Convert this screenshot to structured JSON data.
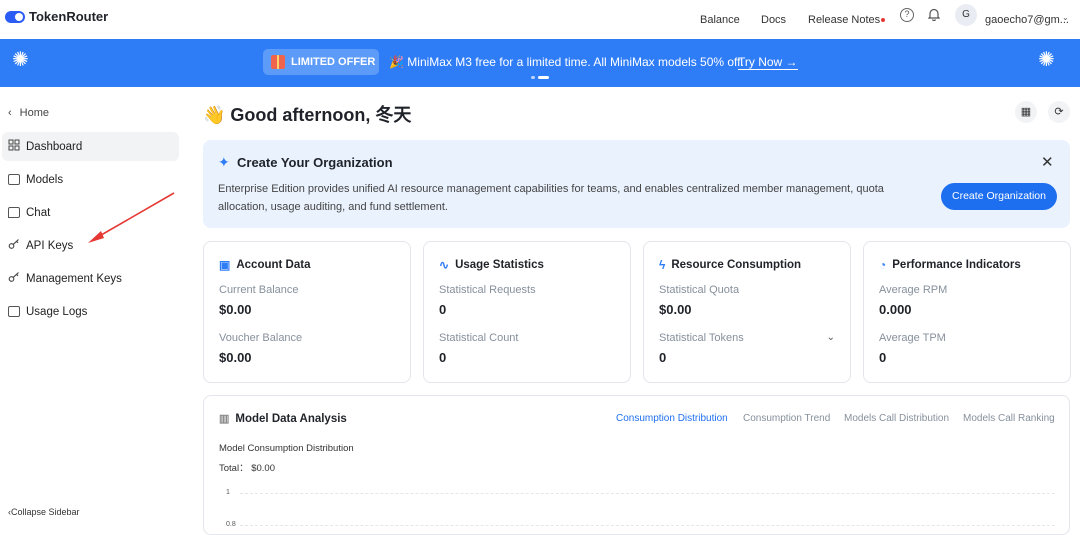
{
  "app": {
    "name": "TokenRouter"
  },
  "topnav": {
    "balance": "Balance",
    "docs": "Docs",
    "release_notes": "Release Notes",
    "help_icon": "help-circle-icon",
    "bell_icon": "bell-icon",
    "avatar_initial": "G",
    "user_email": "gaoecho7@gm..."
  },
  "banner": {
    "badge": "LIMITED OFFER",
    "message": "🎉 MiniMax M3 free for a limited time. All MiniMax models 50% off.",
    "cta": "Try Now →",
    "bg_color": "#2f7df6"
  },
  "sidebar": {
    "home": "Home",
    "items": [
      {
        "label": "Dashboard",
        "icon": "dashboard-icon",
        "active": true
      },
      {
        "label": "Models",
        "icon": "models-icon"
      },
      {
        "label": "Chat",
        "icon": "chat-icon"
      },
      {
        "label": "API Keys",
        "icon": "key-icon"
      },
      {
        "label": "Management Keys",
        "icon": "key-icon"
      },
      {
        "label": "Usage Logs",
        "icon": "logs-icon"
      }
    ],
    "collapse": "Collapse Sidebar"
  },
  "main": {
    "greeting": "👋 Good afternoon, 冬天",
    "org_card": {
      "title": "Create Your Organization",
      "description": "Enterprise Edition provides unified AI resource management capabilities for teams, and enables centralized member management, quota allocation, usage auditing, and fund settlement.",
      "button": "Create Organization"
    },
    "stats": {
      "account": {
        "title": "Account Data",
        "l1": "Current Balance",
        "v1": "$0.00",
        "l2": "Voucher Balance",
        "v2": "$0.00"
      },
      "usage": {
        "title": "Usage Statistics",
        "l1": "Statistical Requests",
        "v1": "0",
        "l2": "Statistical Count",
        "v2": "0"
      },
      "resource": {
        "title": "Resource Consumption",
        "l1": "Statistical Quota",
        "v1": "$0.00",
        "l2": "Statistical Tokens",
        "v2": "0"
      },
      "performance": {
        "title": "Performance Indicators",
        "l1": "Average RPM",
        "v1": "0.000",
        "l2": "Average TPM",
        "v2": "0"
      }
    },
    "analysis": {
      "title": "Model Data Analysis",
      "tabs": [
        "Consumption Distribution",
        "Consumption Trend",
        "Models Call Distribution",
        "Models Call Ranking"
      ],
      "subtitle": "Model Consumption Distribution",
      "total": "Total： $0.00",
      "y_ticks": [
        "1",
        "0.8"
      ]
    }
  },
  "colors": {
    "accent": "#1e6ff0",
    "org_bg": "#eaf2fe"
  }
}
